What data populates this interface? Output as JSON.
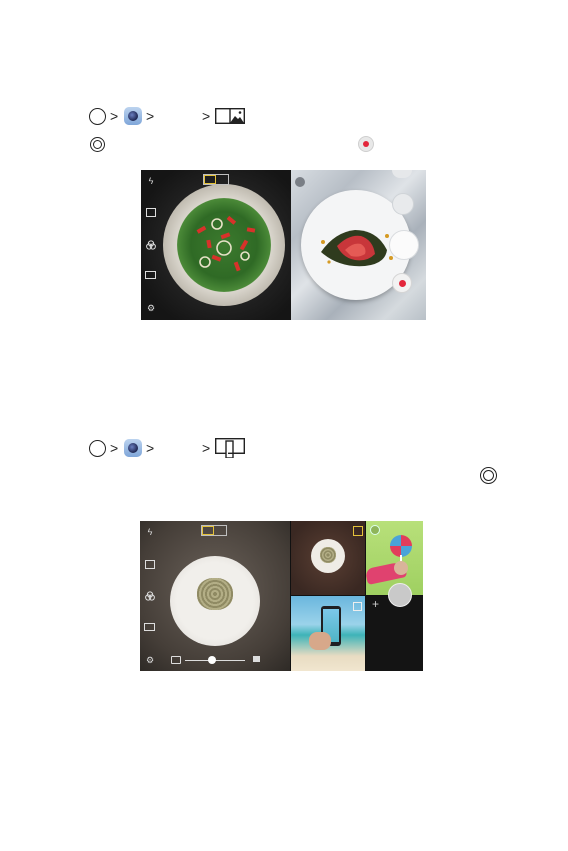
{
  "row1": {
    "icons": [
      "home-circle-icon",
      "chevron-right-icon",
      "camera-app-icon",
      "chevron-right-icon",
      "chevron-right-icon",
      "split-view-mode-icon"
    ]
  },
  "row2": {
    "icons": [
      "shutter-ring-icon",
      "record-button-icon"
    ]
  },
  "row3": {
    "icons": [
      "home-circle-icon",
      "chevron-right-icon",
      "camera-app-icon",
      "chevron-right-icon",
      "chevron-right-icon",
      "grid-shot-mode-icon"
    ]
  },
  "row4": {
    "icons": [
      "shutter-ring-icon"
    ]
  },
  "screen1": {
    "mode_toggle": [
      "",
      ""
    ],
    "side_icons": [
      "flash-off-icon",
      "switch-camera-icon",
      "filter-icon",
      "aspect-ratio-icon",
      "settings-icon"
    ],
    "right_controls": [
      "collapse-chevron-icon",
      "gallery-icon",
      "shutter-button",
      "record-button"
    ]
  },
  "screen2": {
    "mode_toggle": [
      "",
      ""
    ],
    "side_icons": [
      "flash-off-icon",
      "switch-camera-icon",
      "filter-icon",
      "aspect-ratio-icon",
      "settings-icon"
    ],
    "zoom_slider_level": 0.45,
    "grid_tiles": [
      "noodles-thumbnail",
      "lollipop-thumbnail",
      "phone-beach-thumbnail",
      "empty-slot"
    ]
  },
  "colors": {
    "record_red": "#e3263b",
    "mode_accent": "#e4c23a"
  }
}
